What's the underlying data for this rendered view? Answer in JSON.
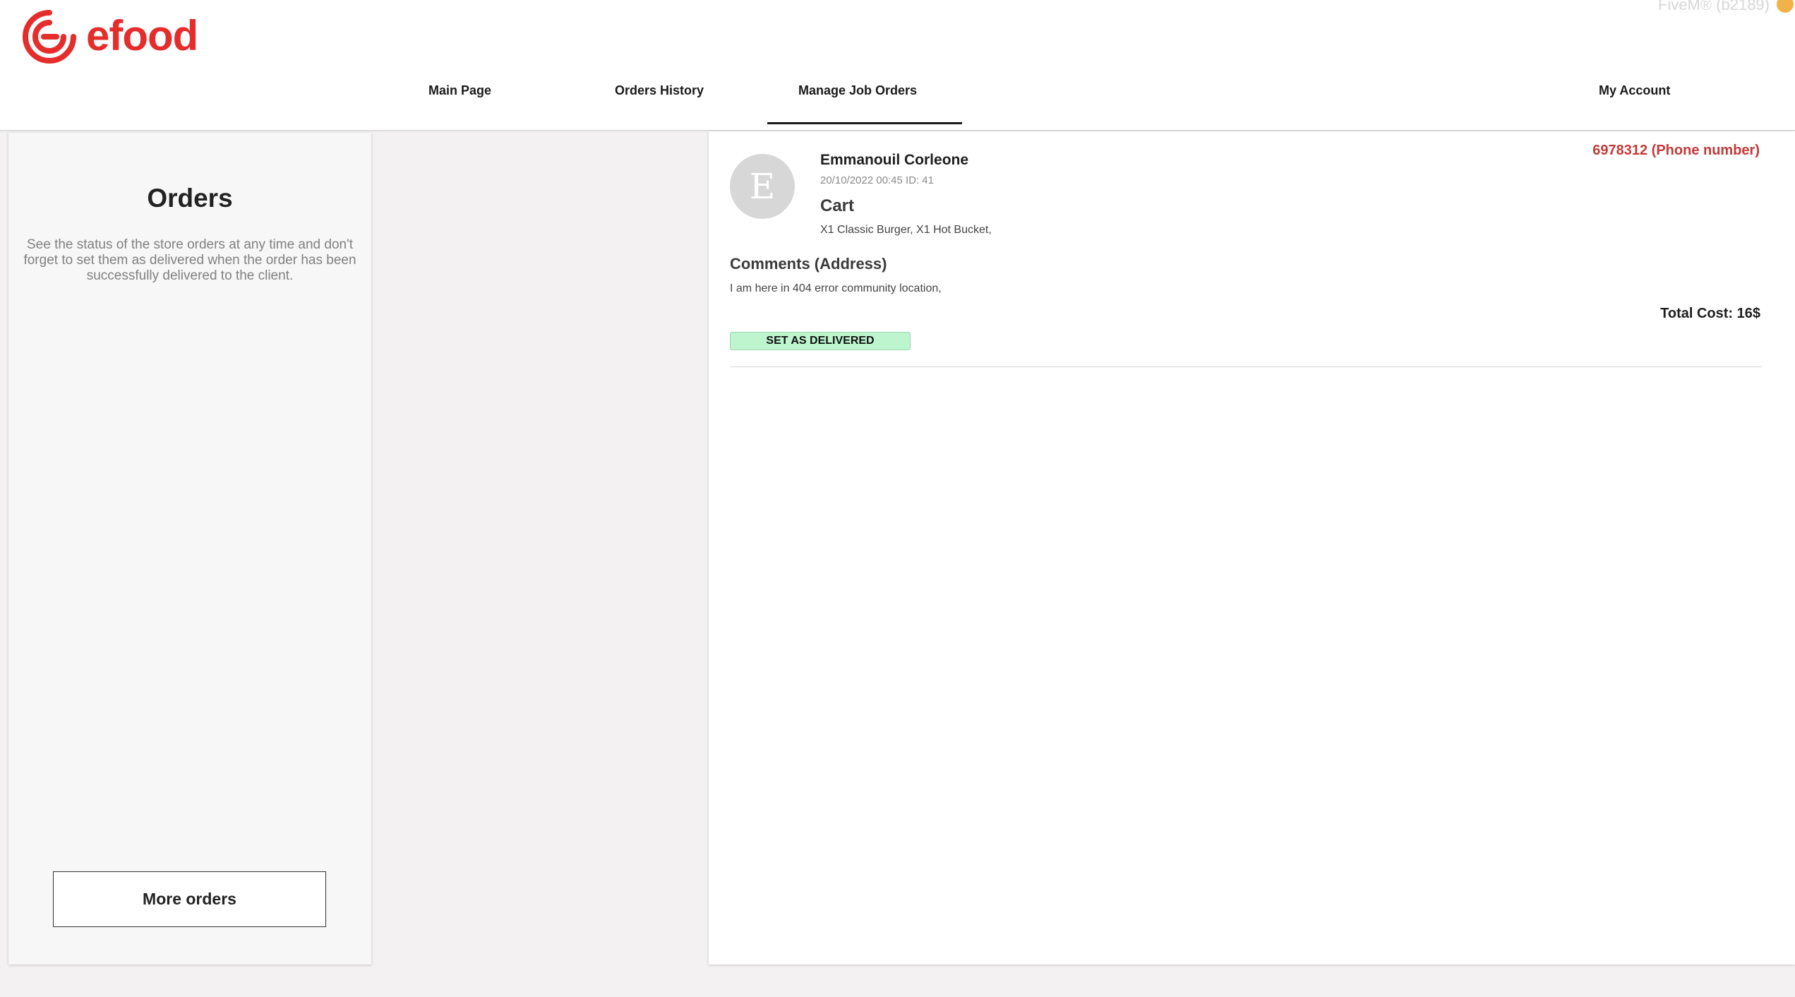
{
  "app": {
    "logo_text": "efood",
    "watermark": "FiveM® (b2189)",
    "brand_color": "#e52d2b"
  },
  "nav": {
    "items": [
      {
        "label": "Main Page",
        "active": false
      },
      {
        "label": "Orders History",
        "active": false
      },
      {
        "label": "Manage Job Orders",
        "active": true
      },
      {
        "label": "My Account",
        "active": false
      }
    ]
  },
  "left_panel": {
    "title": "Orders",
    "description": "See the status of the store orders at any time and don't forget to set them as delivered when the order has been successfully delivered to the client.",
    "more_orders_label": "More orders"
  },
  "order": {
    "avatar_initial": "E",
    "customer_name": "Emmanouil Corleone",
    "meta": "20/10/2022 00:45 ID: 41",
    "cart_heading": "Cart",
    "cart_items": "X1 Classic Burger, X1 Hot Bucket,",
    "phone": "6978312 (Phone number)",
    "comments_heading": "Comments (Address)",
    "comments_text": "I am here in 404 error community location,",
    "total_cost": "Total Cost: 16$",
    "deliver_label": "SET AS DELIVERED",
    "deliver_color": "#bdf5cf",
    "phone_color": "#c23a3a"
  }
}
